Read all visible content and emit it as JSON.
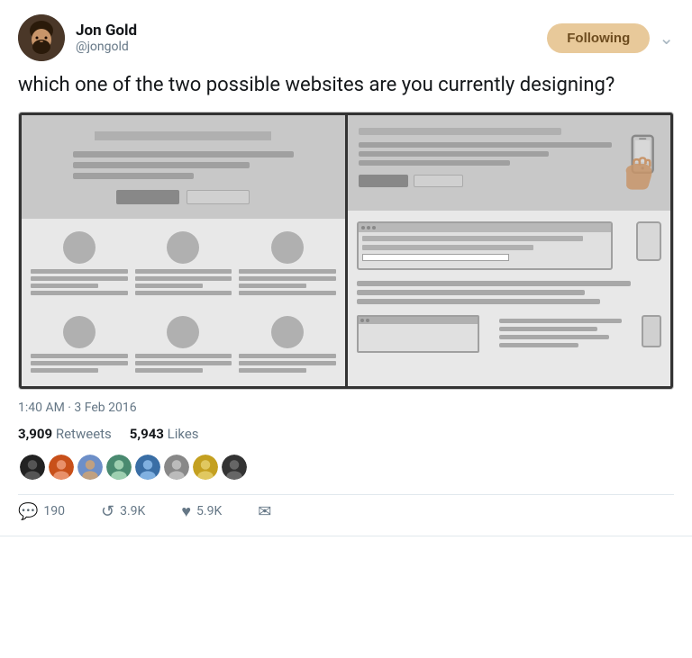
{
  "tweet": {
    "display_name": "Jon Gold",
    "username": "@jongold",
    "following_label": "Following",
    "text": "which one of the two possible websites are you currently designing?",
    "timestamp": "1:40 AM · 3 Feb 2016",
    "retweets_count": "3,909",
    "retweets_label": "Retweets",
    "likes_count": "5,943",
    "likes_label": "Likes",
    "actions": {
      "reply_count": "190",
      "retweet_count": "3.9K",
      "like_count": "5.9K"
    }
  },
  "liker_colors": [
    "#222",
    "#c8501a",
    "#6d8fc8",
    "#4a7c59",
    "#3a6ea5",
    "#888",
    "#c4a020",
    "#333"
  ],
  "icons": {
    "chevron": "›",
    "reply": "↩",
    "retweet": "⟳",
    "like": "♡",
    "share": "✉"
  }
}
